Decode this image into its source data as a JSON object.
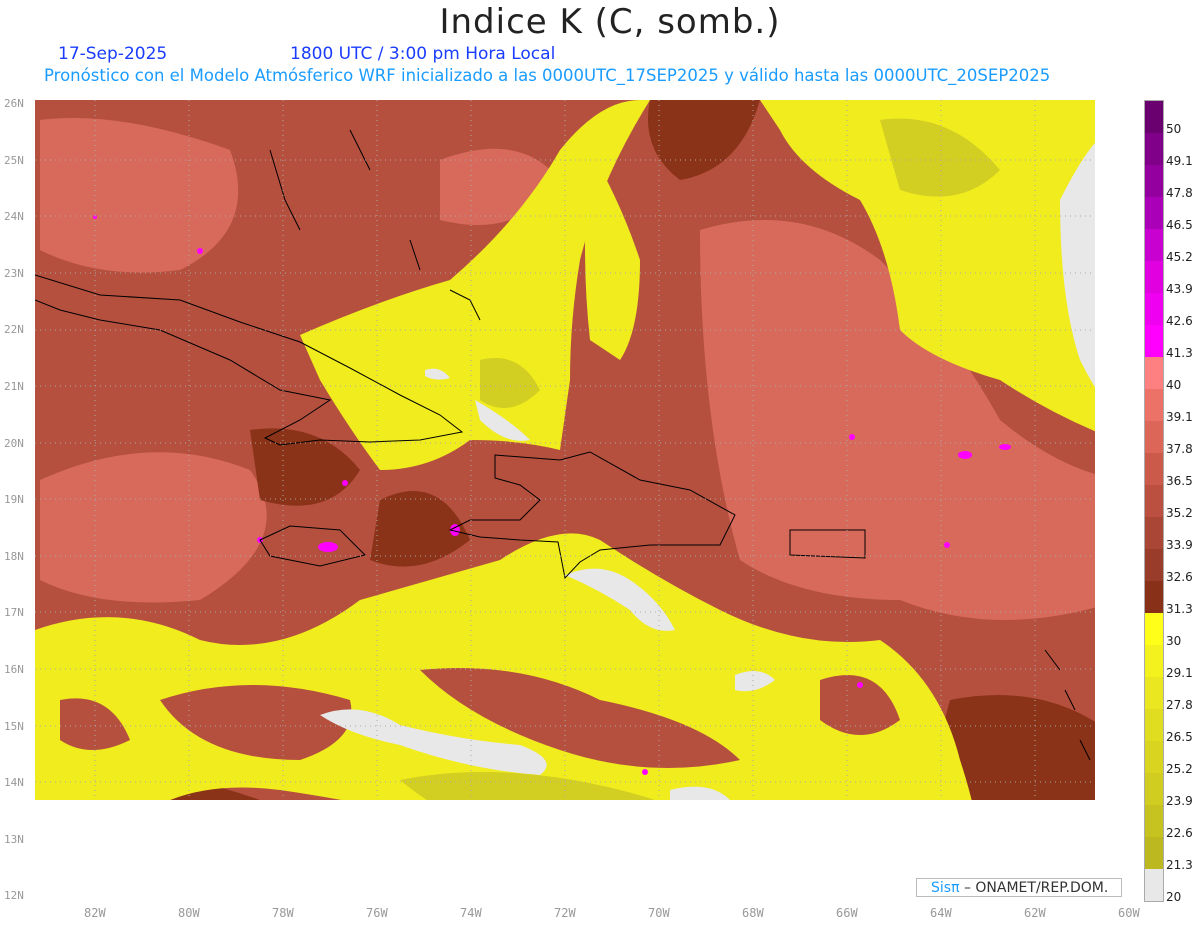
{
  "title": "Indice K (C, somb.)",
  "date": "17-Sep-2025",
  "time": "1800 UTC / 3:00 pm Hora Local",
  "subtitle": "Pronóstico con el Modelo Atmósferico WRF inicializado a las 0000UTC_17SEP2025 y válido hasta las  0000UTC_20SEP2025",
  "lat_labels": [
    "26N",
    "25N",
    "24N",
    "23N",
    "22N",
    "21N",
    "20N",
    "19N",
    "18N",
    "17N",
    "16N",
    "15N",
    "14N",
    "13N",
    "12N"
  ],
  "lon_labels": [
    "82W",
    "80W",
    "78W",
    "76W",
    "74W",
    "72W",
    "70W",
    "68W",
    "66W",
    "64W",
    "62W",
    "60W"
  ],
  "colorbar": {
    "labels": [
      "50",
      "49.1",
      "47.8",
      "46.5",
      "45.2",
      "43.9",
      "42.6",
      "41.3",
      "40",
      "39.1",
      "37.8",
      "36.5",
      "35.2",
      "33.9",
      "32.6",
      "31.3",
      "30",
      "29.1",
      "27.8",
      "26.5",
      "25.2",
      "23.9",
      "22.6",
      "21.3",
      "20"
    ],
    "colors": [
      "#5a0060",
      "#6a0070",
      "#80008a",
      "#9400a0",
      "#aa00b8",
      "#c800d0",
      "#e000e0",
      "#f000f0",
      "#ff00ff",
      "#ff8080",
      "#ec7268",
      "#dc6658",
      "#cc5a4a",
      "#bb5040",
      "#aa4636",
      "#9a3c2a",
      "#883018",
      "#ffff1a",
      "#f4f21e",
      "#eae620",
      "#e0dc20",
      "#d8d420",
      "#d0cc20",
      "#c6c220",
      "#bcb820",
      "#e8e8e8"
    ]
  },
  "credit": {
    "brand": "Sisπ",
    "text": " –  ONAMET/REP.DOM."
  }
}
